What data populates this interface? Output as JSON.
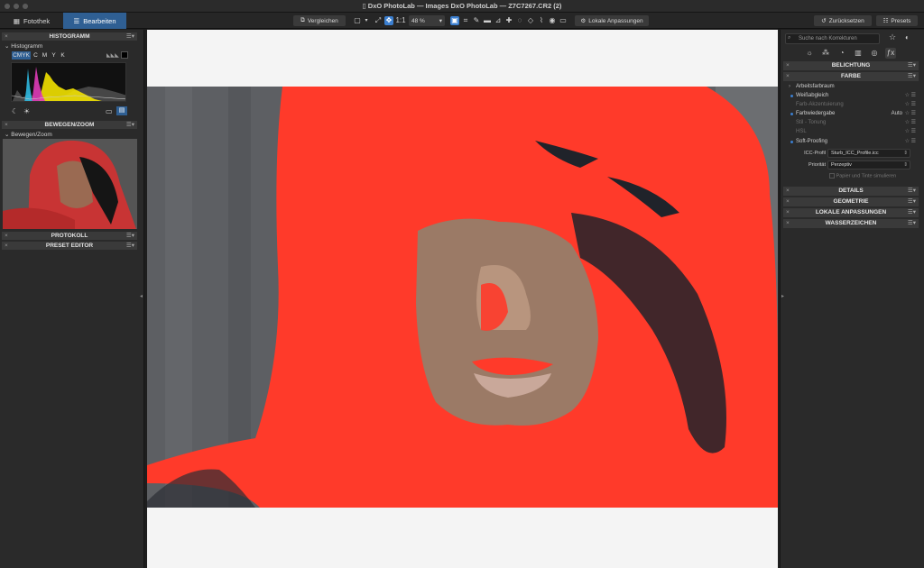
{
  "window": {
    "title": "DxO PhotoLab — Images DxO PhotoLab — Z7C7267.CR2 (2)"
  },
  "toolbar": {
    "tabs": [
      {
        "label": "Fotothek"
      },
      {
        "label": "Bearbeiten"
      }
    ],
    "compare_label": "Vergleichen",
    "zoom_1to1": "1:1",
    "zoom_level": "48 %",
    "local_adjust_label": "Lokale Anpassungen",
    "reset_label": "Zurücksetzen",
    "presets_label": "Presets"
  },
  "left": {
    "histogram_header": "HISTOGRAMM",
    "histogram_sub": "Histogramm",
    "channels": [
      "CMYK",
      "C",
      "M",
      "Y",
      "K"
    ],
    "move_zoom_header": "BEWEGEN/ZOOM",
    "move_zoom_sub": "Bewegen/Zoom",
    "protocol_header": "PROTOKOLL",
    "preset_editor_header": "PRESET EDITOR"
  },
  "right": {
    "search_placeholder": "Suche nach Korrekturen",
    "belichtung": "BELICHTUNG",
    "farbe": "FARBE",
    "items": [
      {
        "label": "Arbeitsfarbraum"
      },
      {
        "label": "Weißabgleich"
      },
      {
        "label": "Farb-Akzentuierung"
      },
      {
        "label": "Farbwiedergabe",
        "value": "Auto"
      },
      {
        "label": "Stil - Tonung"
      },
      {
        "label": "HSL"
      },
      {
        "label": "Soft-Proofing"
      }
    ],
    "icc_label": "ICC-Profil",
    "icc_value": "Sturb_ICC_Profile.icc",
    "priority_label": "Priorität",
    "priority_value": "Perzeptiv",
    "simulate_label": "Papier und Tinte simulieren",
    "details": "DETAILS",
    "geometrie": "GEOMETRIE",
    "lokale": "LOKALE ANPASSUNGEN",
    "wasserzeichen": "WASSERZEICHEN"
  },
  "colors": {
    "accent": "#2f5f93",
    "gamut_warning": "#ff3a2a",
    "panel": "#2a2a2a"
  }
}
